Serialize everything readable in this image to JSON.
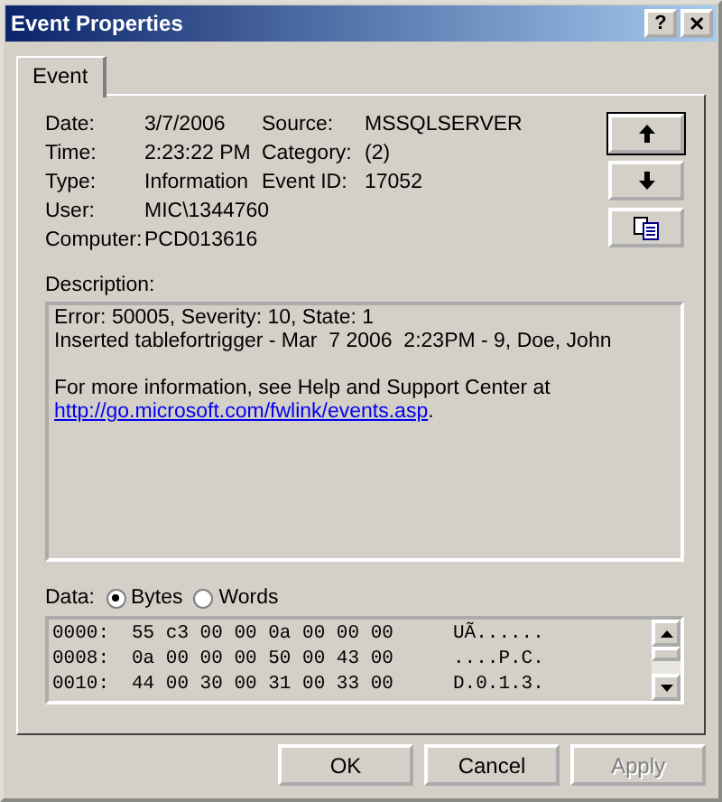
{
  "window": {
    "title": "Event Properties",
    "title_buttons": [
      "?",
      "✕"
    ]
  },
  "tabs": [
    {
      "label": "Event",
      "selected": true
    }
  ],
  "details_left": [
    {
      "label": "Date:",
      "value": "3/7/2006"
    },
    {
      "label": "Time:",
      "value": "2:23:22 PM"
    },
    {
      "label": "Type:",
      "value": "Information"
    },
    {
      "label": "User:",
      "value": "MIC\\1344760"
    },
    {
      "label": "Computer:",
      "value": "PCD013616"
    }
  ],
  "details_right": [
    {
      "label": "Source:",
      "value": "MSSQLSERVER"
    },
    {
      "label": "Category:",
      "value": "(2)"
    },
    {
      "label": "Event ID:",
      "value": "17052"
    }
  ],
  "side_buttons": [
    {
      "kind": "up"
    },
    {
      "kind": "down"
    },
    {
      "kind": "copy"
    }
  ],
  "description": {
    "label": "Description:",
    "paragraphs": [
      [
        "Error: 50005, Severity: 10, State: 1",
        "Inserted tablefortrigger - Mar  7 2006  2:23PM - 9, Doe, John"
      ],
      [
        "For more information, see Help and Support Center at"
      ]
    ],
    "link": "http://go.microsoft.com/fwlink/events.asp",
    "link_suffix": "."
  },
  "data": {
    "label": "Data:",
    "formats": [
      {
        "label": "Bytes",
        "selected": true
      },
      {
        "label": "Words",
        "selected": false
      }
    ],
    "rows": [
      {
        "offset": "0000:",
        "hex": "55 c3 00 00 0a 00 00 00",
        "ascii": "UÃ......"
      },
      {
        "offset": "0008:",
        "hex": "0a 00 00 00 50 00 43 00",
        "ascii": "....P.C."
      },
      {
        "offset": "0010:",
        "hex": "44 00 30 00 31 00 33 00",
        "ascii": "D.0.1.3."
      }
    ]
  },
  "buttons": [
    {
      "label": "OK",
      "disabled": false
    },
    {
      "label": "Cancel",
      "disabled": false
    },
    {
      "label": "Apply",
      "disabled": true
    }
  ]
}
